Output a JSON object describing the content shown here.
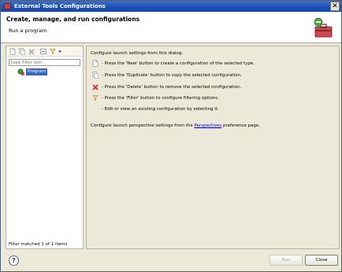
{
  "window": {
    "title": "External Tools Configurations",
    "close_glyph": "✕"
  },
  "header": {
    "title": "Create, manage, and run configurations",
    "subtitle": "Run a program",
    "icon": "toolbox-icon"
  },
  "left_pane": {
    "toolbar_icons": [
      "new-config-icon",
      "duplicate-icon",
      "delete-icon",
      "collapse-all-icon",
      "filter-icon",
      "dropdown-arrow-icon"
    ],
    "filter_placeholder": "type filter text",
    "tree_items": [
      {
        "label": "Program",
        "icon": "program-icon",
        "selected": true
      }
    ],
    "status": "Filter matched 1 of 1 items"
  },
  "right_pane": {
    "intro": "Configure launch settings from this dialog:",
    "lines": [
      {
        "icon": "new-config-icon",
        "text": "- Press the 'New' button to create a configuration of the selected type."
      },
      {
        "icon": "duplicate-icon",
        "text": "- Press the 'Duplicate' button to copy the selected configuration."
      },
      {
        "icon": "delete-icon",
        "text": "- Press the 'Delete' button to remove the selected configuration."
      },
      {
        "icon": "filter-icon",
        "text": "- Press the 'Filter' button to configure filtering options."
      },
      {
        "icon": "",
        "text": "- Edit or view an existing configuration by selecting it."
      }
    ],
    "perspectives": {
      "before": "Configure launch perspective settings from the ",
      "link": "Perspectives",
      "after": " preference page."
    }
  },
  "footer": {
    "help_glyph": "?",
    "run_label": "Run",
    "run_enabled": false,
    "close_label": "Close"
  },
  "colors": {
    "title_bar": "#1c4fb8",
    "selection": "#316ac5",
    "dialog_bg": "#ece9d8",
    "link": "#0000cc"
  }
}
